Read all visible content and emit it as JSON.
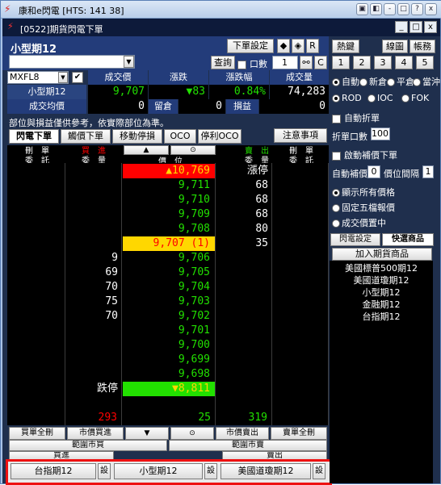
{
  "window": {
    "title": "康和e閃電 [HTS: 141 38]",
    "min_label": "-",
    "max_label": "□",
    "close_label": "x",
    "help_label": "?",
    "sys2": "▣",
    "sys3": "◧"
  },
  "subwindow": {
    "title": "[0522]期貨閃電下單",
    "btn_min": "_",
    "btn_max": "□",
    "btn_close": "x"
  },
  "toolbar": {
    "symbol_name": "小型期12",
    "order_setting": "下單設定",
    "query": "查詢",
    "lots_label": "口數",
    "lots_value": "1",
    "r_label": "R",
    "c_label": "C"
  },
  "right_top": {
    "btn1": "熱鍵",
    "btn2": "線圖",
    "btn3": "帳務",
    "nums": [
      "1",
      "2",
      "3",
      "4",
      "5"
    ]
  },
  "quote": {
    "code": "MXFL8",
    "headers": [
      "成交價",
      "漲跌",
      "漲跌幅",
      "成交量"
    ],
    "name": "小型期12",
    "price": "9,707",
    "change": "▼83",
    "change_pct": "0.84%",
    "volume": "74,283",
    "avg_label": "成交均價",
    "avg_value": "0",
    "keep_label": "留倉",
    "keep_value": "0",
    "pl_label": "損益",
    "pl_value": "0"
  },
  "notice": "部位與損益僅供參考，依實際部位為準。",
  "tabs": [
    "閃電下單",
    "觸價下單",
    "移動停損",
    "OCO",
    "停利OCO"
  ],
  "notes_btn": "注意事項",
  "grid_header": {
    "del1": "刪　單",
    "entrust1": "委　託",
    "buy": "買　進",
    "buy_qty": "委　量",
    "up": "▲",
    "center": "⊙",
    "price": "價　位",
    "sell": "賣　出",
    "sell_qty": "委　量",
    "del2": "刪　單",
    "entrust2": "委　託"
  },
  "ladder": [
    {
      "price": "▲10,769",
      "kind": "limitup",
      "bid": "",
      "ask": "漲停"
    },
    {
      "price": "9,711",
      "kind": "g",
      "bid": "",
      "ask": "68"
    },
    {
      "price": "9,710",
      "kind": "g",
      "bid": "",
      "ask": "68"
    },
    {
      "price": "9,709",
      "kind": "g",
      "bid": "",
      "ask": "68"
    },
    {
      "price": "9,708",
      "kind": "g",
      "bid": "",
      "ask": "80"
    },
    {
      "price": "9,707 (1)",
      "kind": "last",
      "bid": "",
      "ask": "35"
    },
    {
      "price": "9,706",
      "kind": "g",
      "bid": "9",
      "ask": ""
    },
    {
      "price": "9,705",
      "kind": "g",
      "bid": "69",
      "ask": ""
    },
    {
      "price": "9,704",
      "kind": "g",
      "bid": "70",
      "ask": ""
    },
    {
      "price": "9,703",
      "kind": "g",
      "bid": "75",
      "ask": ""
    },
    {
      "price": "9,702",
      "kind": "g",
      "bid": "70",
      "ask": ""
    },
    {
      "price": "9,701",
      "kind": "g",
      "bid": "",
      "ask": ""
    },
    {
      "price": "9,700",
      "kind": "g",
      "bid": "",
      "ask": ""
    },
    {
      "price": "9,699",
      "kind": "g",
      "bid": "",
      "ask": ""
    },
    {
      "price": "9,698",
      "kind": "g",
      "bid": "",
      "ask": ""
    },
    {
      "price": "▼8,811",
      "kind": "limitdown",
      "bid": "跌停",
      "ask": ""
    }
  ],
  "totals": {
    "bid_total": "293",
    "center_total": "25",
    "ask_total": "319"
  },
  "bottom_buttons": {
    "buy_all_del": "買單全刪",
    "mkt_buy": "市價買進",
    "down": "▼",
    "center": "⊙",
    "mkt_sell": "市價賣出",
    "sell_all_del": "賣單全刪",
    "range_buy": "範圍市買",
    "range_sell": "範圍市賣",
    "buy": "買進",
    "sell": "賣出"
  },
  "quick": [
    {
      "name": "台指期12",
      "set": "設"
    },
    {
      "name": "小型期12",
      "set": "設"
    },
    {
      "name": "美國道瓊期12",
      "set": "設"
    }
  ],
  "side": {
    "price_mode": [
      "自動",
      "新倉",
      "平倉",
      "當沖"
    ],
    "tif": [
      "ROD",
      "IOC",
      "FOK"
    ],
    "auto_split": "自動折單",
    "split_label": "折單口數",
    "split_value": "100",
    "start_fill": "啟動補價下單",
    "auto_fill_label": "自動補價",
    "auto_fill_value": "0",
    "interval_label": "價位間隔",
    "interval_value": "1",
    "show_opts": [
      "顯示所有價格",
      "固定五檔報價",
      "成交價置中"
    ],
    "tab1": "閃電設定",
    "tab2": "快選商品",
    "add_btn": "加入期貨商品",
    "products": [
      "美國標普500期12",
      "美國道瓊期12",
      "小型期12",
      "金融期12",
      "台指期12"
    ]
  },
  "colors": {
    "accent": "#233c7a",
    "green": "#22e000",
    "red": "#ff0000",
    "yellow": "#ffd700",
    "frame": "#e11111"
  }
}
